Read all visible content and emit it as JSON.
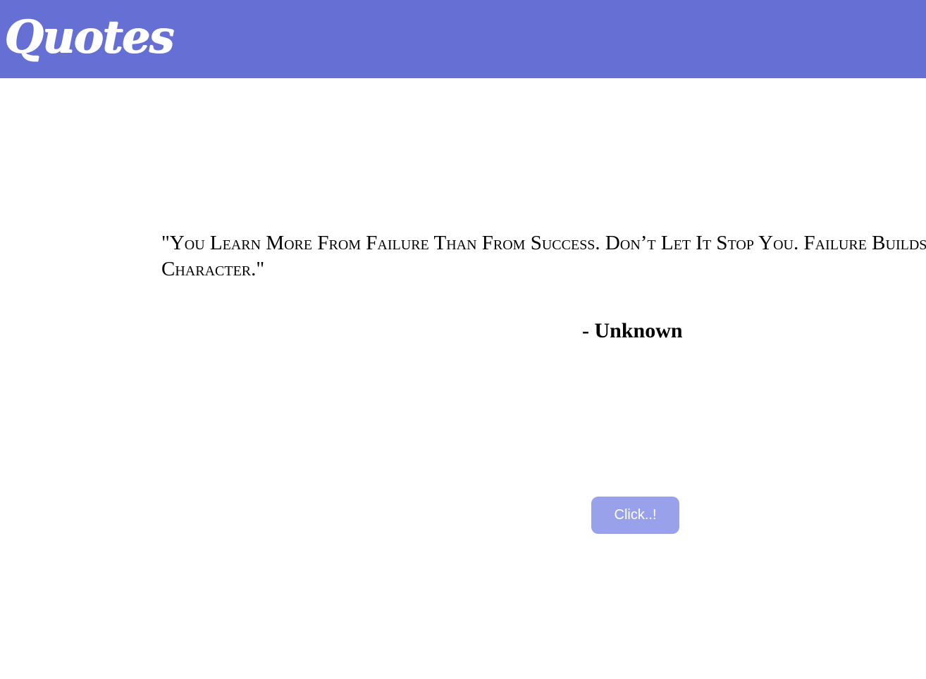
{
  "header": {
    "logo_text": "Quotes",
    "background_color": "#6670d4"
  },
  "quote": {
    "text": "\"You Learn More From Failure Than From Success. Don’t Let It Stop You. Failure Builds Character.\"",
    "author": "- Unknown"
  },
  "actions": {
    "click_label": "Click..!",
    "button_color": "#98a1ea"
  }
}
